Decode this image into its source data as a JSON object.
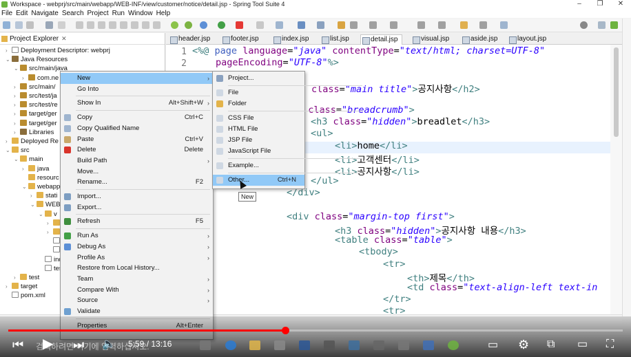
{
  "window": {
    "title": "Workspace - webprj/src/main/webapp/WEB-INF/view/customer/notice/detail.jsp - Spring Tool Suite 4",
    "controls": [
      "–",
      "❐",
      "✕"
    ]
  },
  "menubar": [
    "File",
    "Edit",
    "Navigate",
    "Search",
    "Project",
    "Run",
    "Window",
    "Help"
  ],
  "explorer": {
    "tab_label": "Project Explorer",
    "items": [
      {
        "label": "Deployment Descriptor: webprj",
        "caret": "›",
        "icon": "descriptor"
      },
      {
        "label": "Java Resources",
        "caret": "⌄",
        "icon": "jar"
      },
      {
        "label": "src/main/java",
        "caret": "⌄",
        "icon": "pkg"
      },
      {
        "label": "com.ne",
        "caret": "›",
        "icon": "pkg"
      },
      {
        "label": "src/main/",
        "caret": "›",
        "icon": "pkg"
      },
      {
        "label": "src/test/ja",
        "caret": "›",
        "icon": "pkg"
      },
      {
        "label": "src/test/re",
        "caret": "›",
        "icon": "pkg"
      },
      {
        "label": "target/ger",
        "caret": "›",
        "icon": "pkg"
      },
      {
        "label": "target/ger",
        "caret": "›",
        "icon": "pkg"
      },
      {
        "label": "Libraries",
        "caret": "›",
        "icon": "jar"
      },
      {
        "label": "Deployed Re",
        "caret": "›",
        "icon": "folder"
      },
      {
        "label": "src",
        "caret": "⌄",
        "icon": "folder"
      },
      {
        "label": "main",
        "caret": "⌄",
        "icon": "folder"
      },
      {
        "label": "java",
        "caret": "›",
        "icon": "folder"
      },
      {
        "label": "resourc",
        "caret": "",
        "icon": "folder"
      },
      {
        "label": "webapp",
        "caret": "⌄",
        "icon": "folder"
      },
      {
        "label": "stati",
        "caret": "›",
        "icon": "folder"
      },
      {
        "label": "WEB",
        "caret": "⌄",
        "icon": "folder"
      },
      {
        "label": "v",
        "caret": "⌄",
        "icon": "folder"
      },
      {
        "label": "",
        "caret": "›",
        "icon": "folder"
      },
      {
        "label": "",
        "caret": "›",
        "icon": "folder"
      },
      {
        "label": "c",
        "caret": "",
        "icon": "xml"
      },
      {
        "label": "v",
        "caret": "",
        "icon": "xml"
      },
      {
        "label": "inde",
        "caret": "",
        "icon": "xml"
      },
      {
        "label": "test.",
        "caret": "",
        "icon": "xml"
      },
      {
        "label": "test",
        "caret": "›",
        "icon": "folder"
      },
      {
        "label": "target",
        "caret": "›",
        "icon": "folder"
      },
      {
        "label": "pom.xml",
        "caret": "",
        "icon": "xml"
      }
    ]
  },
  "editor_tabs": [
    "header.jsp",
    "footer.jsp",
    "index.jsp",
    "list.jsp",
    "detail.jsp",
    "visual.jsp",
    "aside.jsp",
    "layout.jsp"
  ],
  "editor": {
    "line_numbers": [
      "1",
      "2"
    ],
    "lines": [
      {
        "parts": [
          [
            "tag",
            "<%@ "
          ],
          [
            "kw",
            "page "
          ],
          [
            "attr",
            "language"
          ],
          [
            "",
            "="
          ],
          [
            "str",
            "\"java\""
          ],
          [
            "",
            " "
          ],
          [
            "attr",
            "contentType"
          ],
          [
            "",
            "="
          ],
          [
            "str",
            "\"text/html; charset=UTF-8\""
          ]
        ]
      },
      {
        "parts": [
          [
            "attr",
            "pageEncoding"
          ],
          [
            "",
            "="
          ],
          [
            "str",
            "\"UTF-8\""
          ],
          [
            "tag",
            "%>"
          ]
        ]
      },
      {
        "parts": []
      },
      {
        "parts": [
          [
            "attr",
            "class"
          ],
          [
            "",
            "="
          ],
          [
            "str",
            "\"main title\""
          ],
          [
            "tag",
            ">"
          ],
          [
            "",
            "공지사항"
          ],
          [
            "tag",
            "</h2>"
          ]
        ]
      },
      {
        "parts": []
      },
      {
        "parts": [
          [
            "tag",
            "v "
          ],
          [
            "attr",
            "class"
          ],
          [
            "",
            "="
          ],
          [
            "str",
            "\"breadcrumb\""
          ],
          [
            "tag",
            ">"
          ]
        ]
      },
      {
        "parts": [
          [
            "tag",
            "<h3 "
          ],
          [
            "attr",
            "class"
          ],
          [
            "",
            "="
          ],
          [
            "str",
            "\"hidden\""
          ],
          [
            "tag",
            ">"
          ],
          [
            "",
            "breadlet"
          ],
          [
            "tag",
            "</h3>"
          ]
        ]
      },
      {
        "parts": [
          [
            "tag",
            "<ul>"
          ]
        ]
      },
      {
        "parts": [
          [
            "tag",
            "<li>"
          ],
          [
            "",
            "home"
          ],
          [
            "tag",
            "</li>"
          ]
        ]
      },
      {
        "parts": [
          [
            "tag",
            "<li>"
          ],
          [
            "",
            "고객센터"
          ],
          [
            "tag",
            "</li>"
          ]
        ]
      },
      {
        "parts": [
          [
            "tag",
            "<li>"
          ],
          [
            "",
            "공지사항"
          ],
          [
            "tag",
            "</li>"
          ]
        ]
      },
      {
        "parts": [
          [
            "tag",
            "</ul>"
          ]
        ]
      },
      {
        "parts": [
          [
            "tag",
            "</div>"
          ]
        ]
      },
      {
        "parts": []
      },
      {
        "parts": [
          [
            "tag",
            "<div "
          ],
          [
            "attr",
            "class"
          ],
          [
            "",
            "="
          ],
          [
            "str",
            "\"margin-top first\""
          ],
          [
            "tag",
            ">"
          ]
        ]
      },
      {
        "parts": [
          [
            "tag",
            "<h3 "
          ],
          [
            "attr",
            "class"
          ],
          [
            "",
            "="
          ],
          [
            "str",
            "\"hidden\""
          ],
          [
            "tag",
            ">"
          ],
          [
            "",
            "공지사항 내용"
          ],
          [
            "tag",
            "</h3>"
          ]
        ]
      },
      {
        "parts": [
          [
            "tag",
            "<table "
          ],
          [
            "attr",
            "class"
          ],
          [
            "",
            "="
          ],
          [
            "str",
            "\"table\""
          ],
          [
            "tag",
            ">"
          ]
        ]
      },
      {
        "parts": [
          [
            "tag",
            "<tbody>"
          ]
        ]
      },
      {
        "parts": [
          [
            "tag",
            "<tr>"
          ]
        ]
      },
      {
        "parts": [
          [
            "tag",
            "<th>"
          ],
          [
            "",
            "제목"
          ],
          [
            "tag",
            "</th>"
          ]
        ]
      },
      {
        "parts": [
          [
            "tag",
            "<td "
          ],
          [
            "attr",
            "class"
          ],
          [
            "",
            "="
          ],
          [
            "str",
            "\"text-align-left text-in"
          ]
        ]
      },
      {
        "parts": [
          [
            "tag",
            "</tr>"
          ]
        ]
      },
      {
        "parts": [
          [
            "tag",
            "<tr>"
          ]
        ]
      }
    ]
  },
  "context_menu": {
    "items": [
      {
        "label": "New",
        "shortcut": "",
        "submenu": true,
        "selected": true,
        "icon": ""
      },
      {
        "label": "Go Into",
        "shortcut": "",
        "submenu": false,
        "icon": ""
      },
      {
        "sep": true
      },
      {
        "label": "Show In",
        "shortcut": "Alt+Shift+W",
        "submenu": true,
        "icon": ""
      },
      {
        "sep": true
      },
      {
        "label": "Copy",
        "shortcut": "Ctrl+C",
        "submenu": false,
        "icon": "copy"
      },
      {
        "label": "Copy Qualified Name",
        "shortcut": "",
        "submenu": false,
        "icon": "copy"
      },
      {
        "label": "Paste",
        "shortcut": "Ctrl+V",
        "submenu": false,
        "icon": "paste"
      },
      {
        "label": "Delete",
        "shortcut": "Delete",
        "submenu": false,
        "icon": "delete"
      },
      {
        "label": "Build Path",
        "shortcut": "",
        "submenu": true,
        "icon": ""
      },
      {
        "label": "Move...",
        "shortcut": "",
        "submenu": false,
        "icon": ""
      },
      {
        "label": "Rename...",
        "shortcut": "F2",
        "submenu": false,
        "icon": ""
      },
      {
        "sep": true
      },
      {
        "label": "Import...",
        "shortcut": "",
        "submenu": false,
        "icon": "import"
      },
      {
        "label": "Export...",
        "shortcut": "",
        "submenu": false,
        "icon": "export"
      },
      {
        "sep": true
      },
      {
        "label": "Refresh",
        "shortcut": "F5",
        "submenu": false,
        "icon": "refresh"
      },
      {
        "sep": true
      },
      {
        "label": "Run As",
        "shortcut": "",
        "submenu": true,
        "icon": "run"
      },
      {
        "label": "Debug As",
        "shortcut": "",
        "submenu": true,
        "icon": "debug"
      },
      {
        "label": "Profile As",
        "shortcut": "",
        "submenu": true,
        "icon": ""
      },
      {
        "label": "Restore from Local History...",
        "shortcut": "",
        "submenu": false,
        "icon": ""
      },
      {
        "label": "Team",
        "shortcut": "",
        "submenu": true,
        "icon": ""
      },
      {
        "label": "Compare With",
        "shortcut": "",
        "submenu": true,
        "icon": ""
      },
      {
        "label": "Source",
        "shortcut": "",
        "submenu": true,
        "icon": ""
      },
      {
        "label": "Validate",
        "shortcut": "",
        "submenu": false,
        "icon": "validate"
      },
      {
        "sep": true
      },
      {
        "label": "Properties",
        "shortcut": "Alt+Enter",
        "submenu": false,
        "icon": ""
      }
    ]
  },
  "submenu": {
    "items": [
      {
        "label": "Project...",
        "shortcut": "",
        "icon": "project"
      },
      {
        "sep": true
      },
      {
        "label": "File",
        "shortcut": "",
        "icon": "file"
      },
      {
        "label": "Folder",
        "shortcut": "",
        "icon": "folder"
      },
      {
        "sep": true
      },
      {
        "label": "CSS File",
        "shortcut": "",
        "icon": "file"
      },
      {
        "label": "HTML File",
        "shortcut": "",
        "icon": "file"
      },
      {
        "label": "JSP File",
        "shortcut": "",
        "icon": "file"
      },
      {
        "label": "JavaScript File",
        "shortcut": "",
        "icon": "file"
      },
      {
        "sep": true
      },
      {
        "label": "Example...",
        "shortcut": "",
        "icon": "file"
      },
      {
        "sep": true
      },
      {
        "label": "Other...",
        "shortcut": "Ctrl+N",
        "icon": "file",
        "selected": true
      }
    ]
  },
  "tooltip": "New",
  "video": {
    "current_time": "5:59",
    "duration": "13:16",
    "time_display": "5:59 / 13:16",
    "progress": 0.451,
    "caption_preview": "검색하려면 여기에 입력하십시오.",
    "accent": "#ff0000"
  }
}
